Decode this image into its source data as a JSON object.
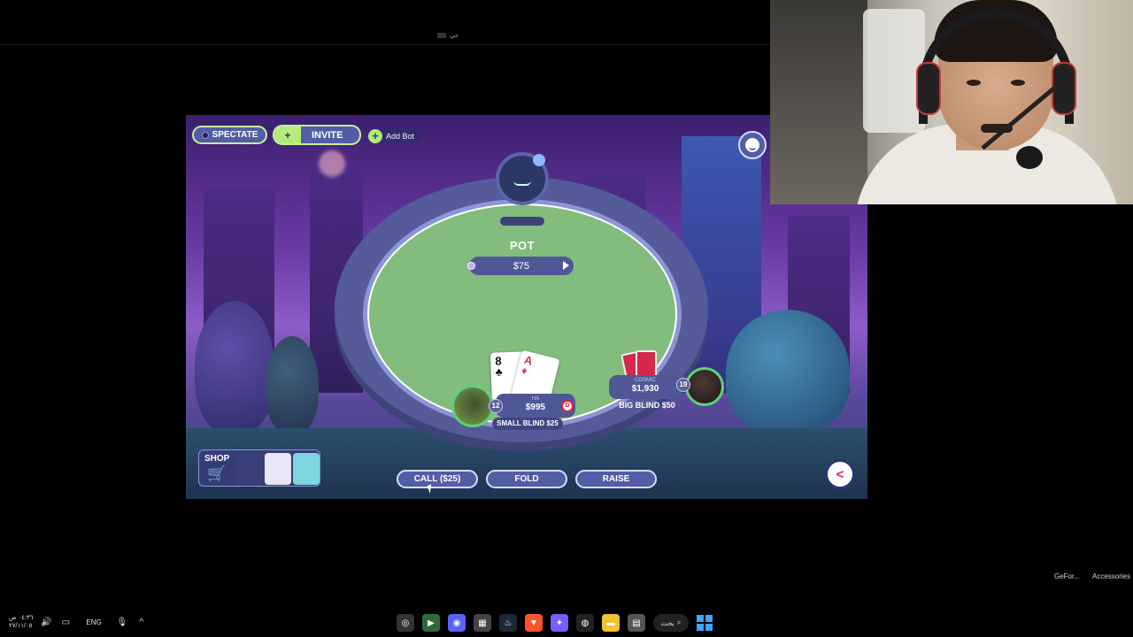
{
  "top_tab": {
    "label": "جي"
  },
  "game": {
    "buttons": {
      "spectate": "SPECTATE",
      "invite": "INVITE",
      "add_bot": "Add Bot"
    },
    "pot": {
      "label": "POT",
      "amount": "$75"
    },
    "me": {
      "name": "HA",
      "stack": "$995",
      "level": "12",
      "dealer": "D",
      "blind": "SMALL BLIND $25",
      "cards": [
        {
          "rank": "8",
          "suit": "♣"
        },
        {
          "rank": "A",
          "suit": "♦"
        }
      ]
    },
    "opponent": {
      "name": "COSMIC",
      "stack": "$1,930",
      "level": "19",
      "blind": "BIG BLIND $50"
    },
    "shop": {
      "label": "SHOP"
    },
    "actions": {
      "call": "CALL ($25)",
      "fold": "FOLD",
      "raise": "RAISE"
    },
    "colors": {
      "felt": "#82bd7e",
      "button_bg": "#535da6",
      "accent_green": "#b3ec7a",
      "card_red": "#d6284a"
    }
  },
  "side_labels": {
    "geforce": "GeFor...",
    "accessories": "Accessories"
  },
  "taskbar": {
    "time": "٠٤:٣٦ ص",
    "date": "٢٧/١١/٠٥",
    "language": "ENG",
    "search": "بحث",
    "icons": [
      "chrome-icon",
      "green-app-icon",
      "discord-icon",
      "store-icon",
      "steam-icon",
      "brave-icon",
      "copilot-icon",
      "obs-icon",
      "folder-icon",
      "notes-icon",
      "search-icon",
      "windows-icon"
    ]
  }
}
